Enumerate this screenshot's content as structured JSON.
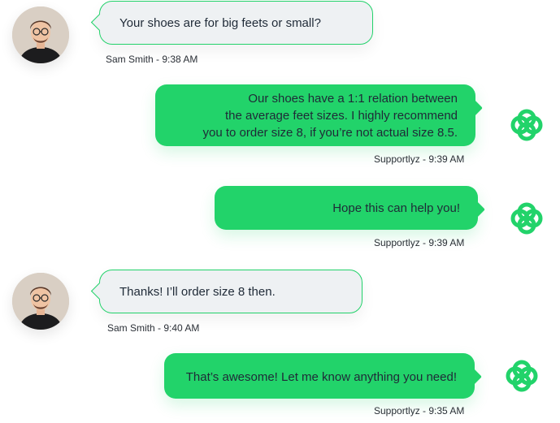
{
  "colors": {
    "accent": "#22d36a",
    "incoming_bg": "#eef1f3",
    "text": "#1f2a37"
  },
  "messages": [
    {
      "sender": "Sam Smith",
      "time": "9:38 AM",
      "meta": "Sam Smith - 9:38 AM",
      "direction": "incoming",
      "lines": [
        "Your shoes are for big feets or small?"
      ]
    },
    {
      "sender": "Supportlyz",
      "time": "9:39 AM",
      "meta": "Supportlyz - 9:39 AM",
      "direction": "outgoing",
      "lines": [
        "Our shoes have a 1:1 relation between",
        "the average feet sizes. I highly recommend",
        "you to order size 8, if you’re not actual size 8.5."
      ]
    },
    {
      "sender": "Supportlyz",
      "time": "9:39 AM",
      "meta": "Supportlyz - 9:39 AM",
      "direction": "outgoing",
      "lines": [
        "Hope this can help you!"
      ]
    },
    {
      "sender": "Sam Smith",
      "time": "9:40 AM",
      "meta": "Sam Smith - 9:40 AM",
      "direction": "incoming",
      "lines": [
        "Thanks! I’ll order size 8 then."
      ]
    },
    {
      "sender": "Supportlyz",
      "time": "9:35 AM",
      "meta": "Supportlyz - 9:35 AM",
      "direction": "outgoing",
      "lines": [
        "That’s awesome! Let me know anything you need!"
      ]
    }
  ]
}
